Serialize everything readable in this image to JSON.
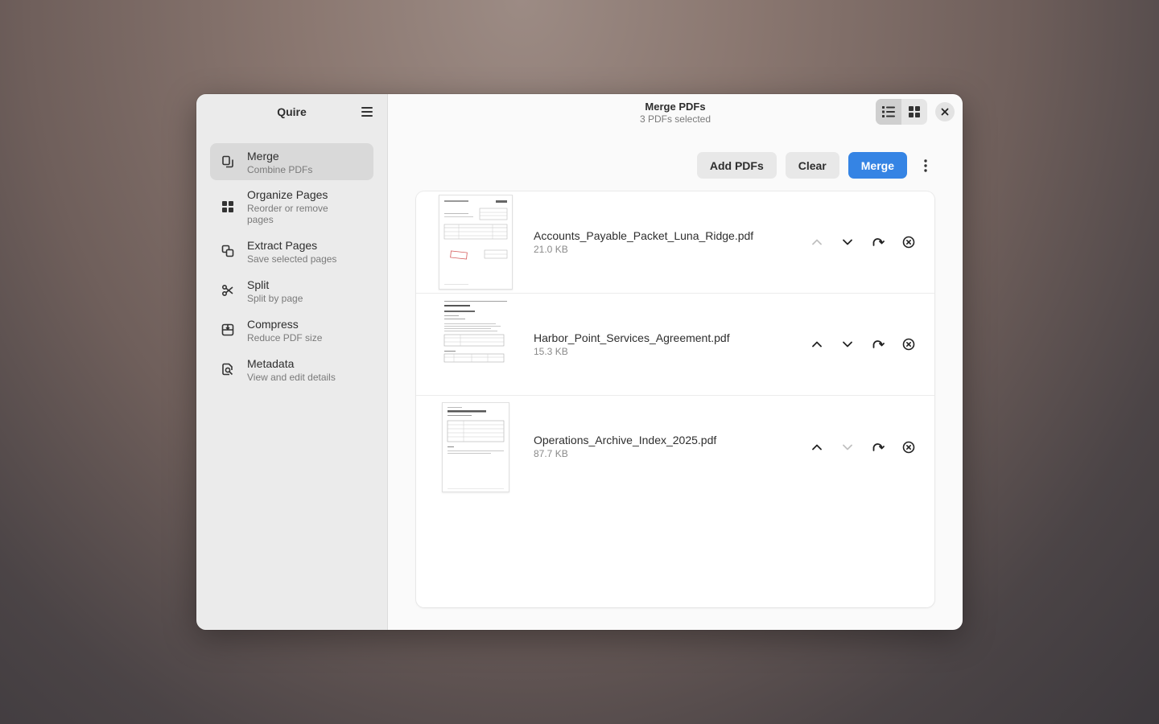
{
  "app": {
    "title": "Quire"
  },
  "sidebar": {
    "items": [
      {
        "label": "Merge",
        "sub": "Combine PDFs",
        "icon": "merge-icon",
        "active": true
      },
      {
        "label": "Organize Pages",
        "sub": "Reorder or remove pages",
        "icon": "grid-icon",
        "active": false
      },
      {
        "label": "Extract Pages",
        "sub": "Save selected pages",
        "icon": "extract-icon",
        "active": false
      },
      {
        "label": "Split",
        "sub": "Split by page",
        "icon": "scissors-icon",
        "active": false
      },
      {
        "label": "Compress",
        "sub": "Reduce PDF size",
        "icon": "compress-icon",
        "active": false
      },
      {
        "label": "Metadata",
        "sub": "View and edit details",
        "icon": "metadata-icon",
        "active": false
      }
    ]
  },
  "header": {
    "title": "Merge PDFs",
    "subtitle": "3 PDFs selected",
    "view_mode": "list"
  },
  "toolbar": {
    "add_label": "Add PDFs",
    "clear_label": "Clear",
    "merge_label": "Merge"
  },
  "files": [
    {
      "name": "Accounts_Payable_Packet_Luna_Ridge.pdf",
      "size": "21.0 KB",
      "up_enabled": false,
      "down_enabled": true
    },
    {
      "name": "Harbor_Point_Services_Agreement.pdf",
      "size": "15.3 KB",
      "up_enabled": true,
      "down_enabled": true
    },
    {
      "name": "Operations_Archive_Index_2025.pdf",
      "size": "87.7 KB",
      "up_enabled": true,
      "down_enabled": false
    }
  ],
  "colors": {
    "accent": "#3584e4",
    "sidebar_bg": "#ebebeb",
    "content_bg": "#fafafa"
  }
}
